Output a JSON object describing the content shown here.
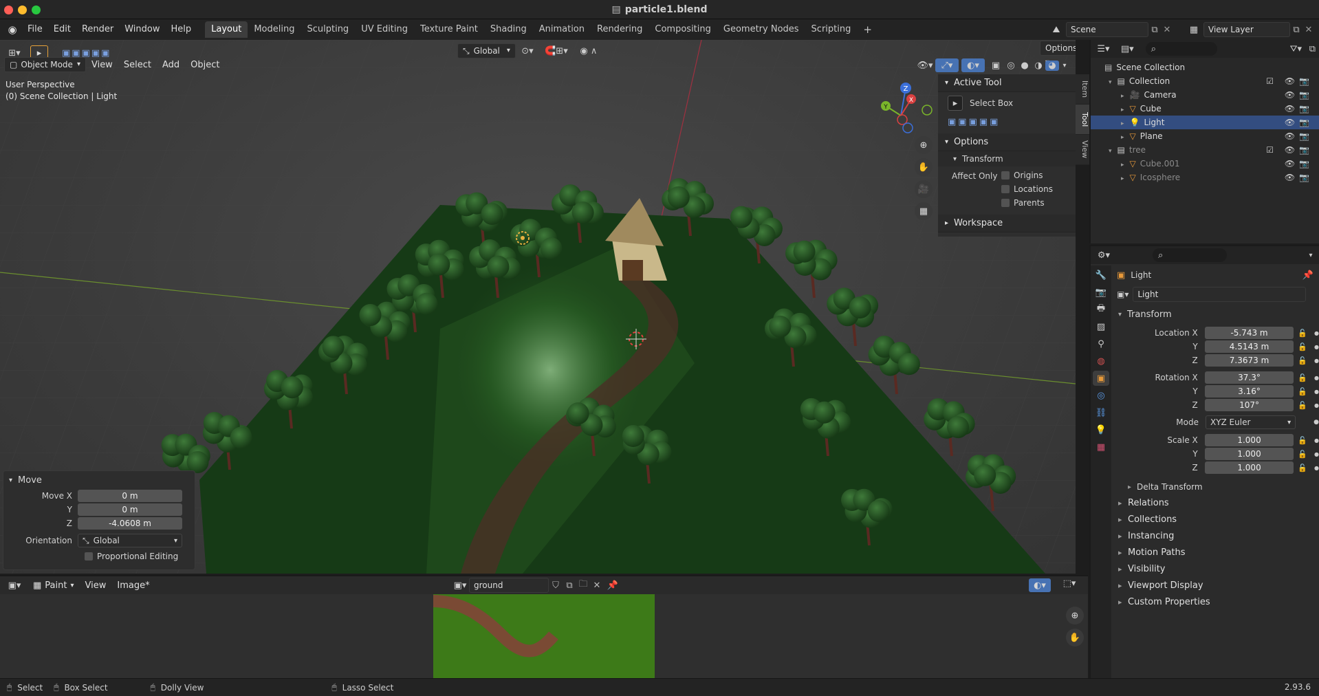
{
  "window": {
    "title": "particle1.blend"
  },
  "menu": [
    "File",
    "Edit",
    "Render",
    "Window",
    "Help"
  ],
  "workspace_tabs": [
    "Layout",
    "Modeling",
    "Sculpting",
    "UV Editing",
    "Texture Paint",
    "Shading",
    "Animation",
    "Rendering",
    "Compositing",
    "Geometry Nodes",
    "Scripting"
  ],
  "active_tab": "Layout",
  "scene": {
    "name": "Scene",
    "view_layer": "View Layer"
  },
  "viewport": {
    "mode": "Object Mode",
    "menus": [
      "View",
      "Select",
      "Add",
      "Object"
    ],
    "transform_orientation": "Global",
    "options_label": "Options",
    "overlay_line1": "User Perspective",
    "overlay_line2": "(0) Scene Collection | Light",
    "gizmo_axes": [
      "Z",
      "X",
      "Y"
    ]
  },
  "npanel": {
    "tabs": [
      "Item",
      "Tool",
      "View"
    ],
    "active_tool_header": "Active Tool",
    "active_tool": "Select Box",
    "options_header": "Options",
    "transform_sub": "Transform",
    "affect_only": "Affect Only",
    "checks": [
      "Origins",
      "Locations",
      "Parents"
    ],
    "workspace_header": "Workspace"
  },
  "move_panel": {
    "title": "Move",
    "labels": [
      "Move X",
      "Y",
      "Z"
    ],
    "values": [
      "0 m",
      "0 m",
      "-4.0608 m"
    ],
    "orientation_label": "Orientation",
    "orientation_value": "Global",
    "proportional": "Proportional Editing"
  },
  "image_editor": {
    "mode": "Paint",
    "menus": [
      "View",
      "Image*"
    ],
    "image_name": "ground"
  },
  "outliner": {
    "root": "Scene Collection",
    "items": [
      {
        "name": "Collection",
        "level": 1,
        "kind": "collection"
      },
      {
        "name": "Camera",
        "level": 2,
        "kind": "camera"
      },
      {
        "name": "Cube",
        "level": 2,
        "kind": "mesh"
      },
      {
        "name": "Light",
        "level": 2,
        "kind": "light",
        "selected": true
      },
      {
        "name": "Plane",
        "level": 2,
        "kind": "mesh"
      },
      {
        "name": "tree",
        "level": 1,
        "kind": "collection",
        "dim": true
      },
      {
        "name": "Cube.001",
        "level": 2,
        "kind": "mesh",
        "dim": true
      },
      {
        "name": "Icosphere",
        "level": 2,
        "kind": "mesh",
        "dim": true
      }
    ]
  },
  "properties": {
    "object_name": "Light",
    "datablock": "Light",
    "transform_header": "Transform",
    "location": {
      "labels": [
        "Location X",
        "Y",
        "Z"
      ],
      "values": [
        "-5.743 m",
        "4.5143 m",
        "7.3673 m"
      ]
    },
    "rotation": {
      "labels": [
        "Rotation X",
        "Y",
        "Z"
      ],
      "values": [
        "37.3°",
        "3.16°",
        "107°"
      ]
    },
    "mode_label": "Mode",
    "mode_value": "XYZ Euler",
    "scale": {
      "labels": [
        "Scale X",
        "Y",
        "Z"
      ],
      "values": [
        "1.000",
        "1.000",
        "1.000"
      ]
    },
    "delta": "Delta Transform",
    "sections": [
      "Relations",
      "Collections",
      "Instancing",
      "Motion Paths",
      "Visibility",
      "Viewport Display",
      "Custom Properties"
    ]
  },
  "statusbar": {
    "items": [
      "Select",
      "Box Select",
      "Dolly View",
      "Lasso Select"
    ],
    "version": "2.93.6"
  },
  "colors": {
    "accent": "#4772b3",
    "selected_row": "#334d80",
    "grass": "#1f4a1c",
    "path": "#5a3a2a"
  }
}
